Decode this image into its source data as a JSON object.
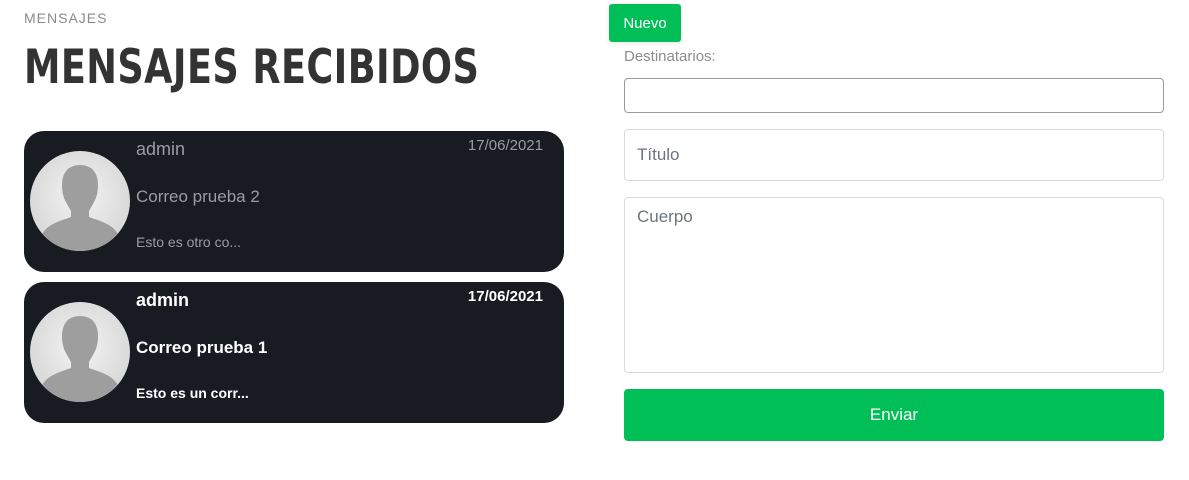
{
  "header": {
    "breadcrumb": "MENSAJES",
    "title": "MENSAJES RECIBIDOS"
  },
  "messages": [
    {
      "sender": "admin",
      "date": "17/06/2021",
      "subject": "Correo prueba 2",
      "preview": "Esto es otro co...",
      "state": "read"
    },
    {
      "sender": "admin",
      "date": "17/06/2021",
      "subject": "Correo prueba 1",
      "preview": "Esto es un corr...",
      "state": "unread"
    }
  ],
  "compose": {
    "new_button_label": "Nuevo",
    "recipients_label": "Destinatarios:",
    "recipients_value": "",
    "title_placeholder": "Título",
    "body_placeholder": "Cuerpo",
    "send_button_label": "Enviar"
  },
  "colors": {
    "accent_green": "#00bf56",
    "card_background": "#191b23",
    "title_text": "#333333"
  },
  "icons": {
    "avatar": "user-silhouette-icon"
  }
}
